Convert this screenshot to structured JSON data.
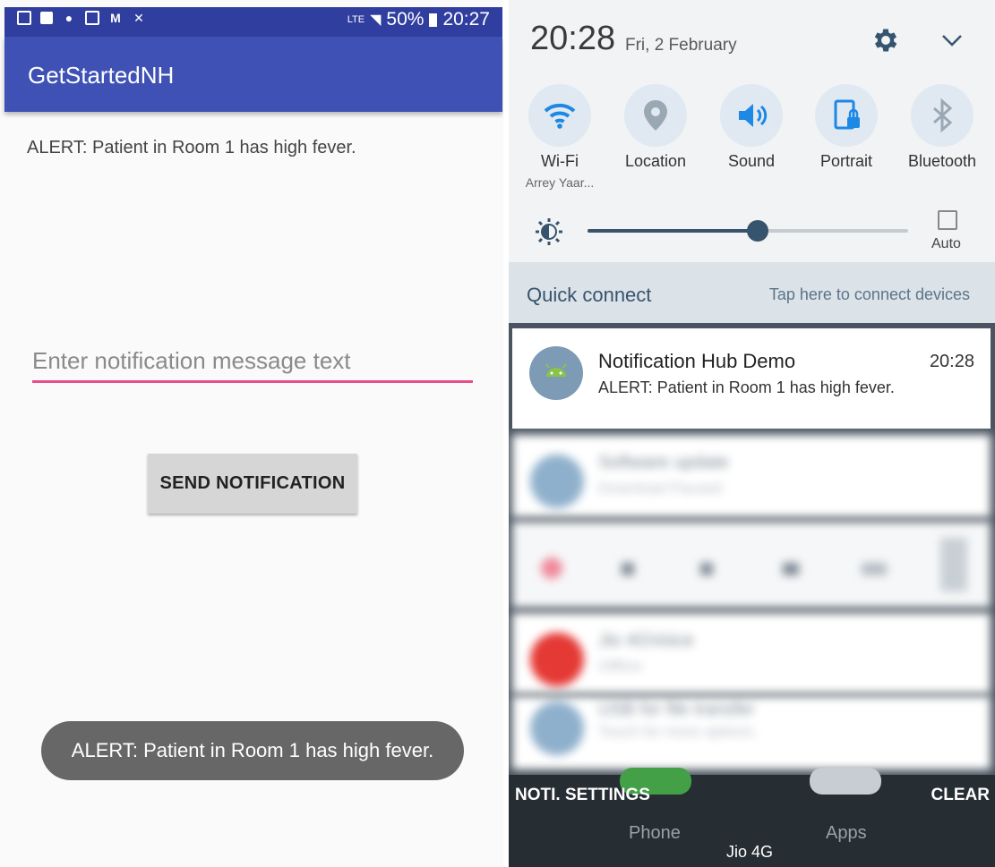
{
  "left": {
    "status_bar": {
      "network": "LTE",
      "battery": "50%",
      "time": "20:27"
    },
    "app_title": "GetStartedNH",
    "received_message": "ALERT: Patient in Room 1 has high fever.",
    "message_input": {
      "placeholder": "Enter notification message text",
      "value": ""
    },
    "send_button": "SEND NOTIFICATION",
    "toast": "ALERT: Patient in Room 1 has high fever."
  },
  "right": {
    "time": "20:28",
    "date": "Fri, 2 February",
    "tiles": [
      {
        "label": "Wi-Fi",
        "sub": "Arrey Yaar...",
        "icon": "wifi-icon"
      },
      {
        "label": "Location",
        "sub": "",
        "icon": "location-icon"
      },
      {
        "label": "Sound",
        "sub": "",
        "icon": "sound-icon"
      },
      {
        "label": "Portrait",
        "sub": "",
        "icon": "portrait-lock-icon"
      },
      {
        "label": "Bluetooth",
        "sub": "",
        "icon": "bluetooth-icon"
      }
    ],
    "brightness": {
      "level": 0.53,
      "auto_label": "Auto",
      "auto_checked": false
    },
    "quick_connect": {
      "title": "Quick connect",
      "hint": "Tap here to connect devices"
    },
    "notification": {
      "title": "Notification Hub Demo",
      "time": "20:28",
      "text": "ALERT: Patient in Room 1 has high fever."
    },
    "blurred": {
      "item1_title": "Software update",
      "item1_sub": "Download Paused",
      "item3_title": "Jio 4GVoice",
      "item3_sub": "Offline",
      "item4_title": "USB for file transfer",
      "item4_sub": "Touch for more options."
    },
    "bottom": {
      "settings_label": "NOTI. SETTINGS",
      "clear_label": "CLEAR",
      "phone_label": "Phone",
      "apps_label": "Apps",
      "carrier": "Jio 4G"
    }
  },
  "colors": {
    "primary": "#3f51b5",
    "primary_dark": "#303f9f",
    "accent": "#e6508a",
    "slider": "#37546e"
  }
}
